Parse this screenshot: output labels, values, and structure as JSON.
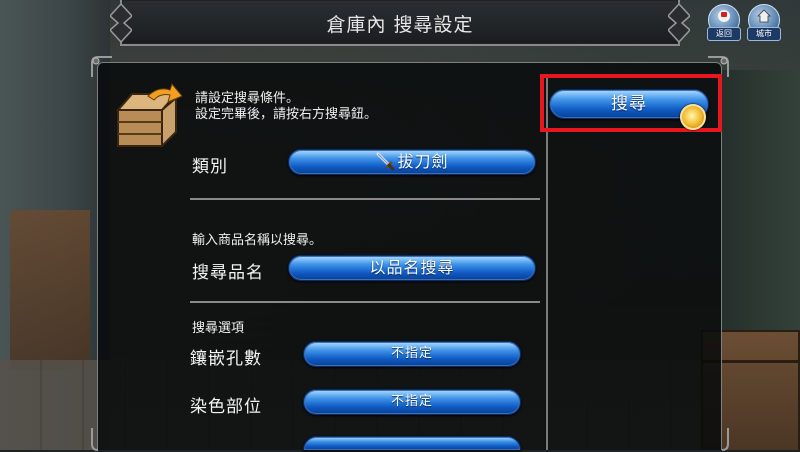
{
  "header": {
    "title": "倉庫內 搜尋設定",
    "back_label": "返回",
    "home_label": "城市"
  },
  "intro": {
    "line1": "請設定搜尋條件。",
    "line2": "設定完畢後，請按右方搜尋鈕。"
  },
  "category": {
    "label": "類別",
    "value": "拔刀劍",
    "icon": "sword-icon"
  },
  "name_search": {
    "hint": "輸入商品名稱以搜尋。",
    "label": "搜尋品名",
    "button": "以品名搜尋"
  },
  "options": {
    "heading": "搜尋選項",
    "rows": [
      {
        "label": "鑲嵌孔數",
        "value": "不指定"
      },
      {
        "label": "染色部位",
        "value": "不指定"
      }
    ]
  },
  "search_button": {
    "label": "搜尋",
    "icon": "coin-cursor-icon",
    "highlight_color": "#e8171f"
  },
  "colors": {
    "button_blue": "#1b6fd8",
    "panel_bg": "#0a0c0e"
  }
}
